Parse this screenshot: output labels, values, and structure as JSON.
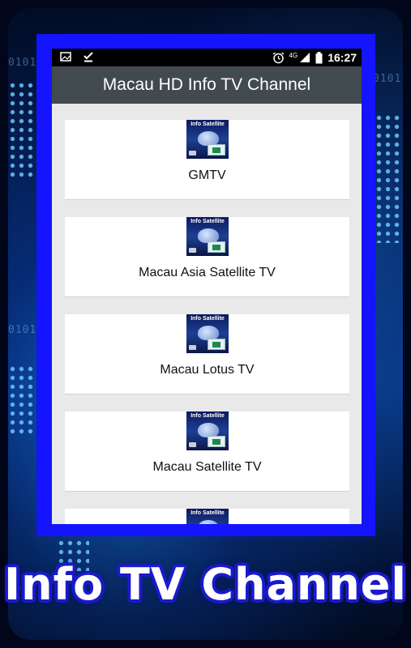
{
  "status_bar": {
    "time": "16:27",
    "network": "4G",
    "left_icons": [
      "image-icon",
      "download-done-icon"
    ],
    "right_icons": [
      "alarm-icon",
      "signal-icon",
      "battery-icon"
    ]
  },
  "app_bar": {
    "title": "Macau HD Info TV Channel"
  },
  "thumbnail": {
    "label": "Info Satellite"
  },
  "channels": [
    {
      "title": "GMTV"
    },
    {
      "title": "Macau Asia Satellite TV"
    },
    {
      "title": "Macau Lotus TV"
    },
    {
      "title": "Macau Satellite TV"
    },
    {
      "title": ""
    }
  ],
  "banner": {
    "text": "Info TV Channel"
  },
  "colors": {
    "frame_blue": "#1414ff",
    "app_bar": "#414a4f",
    "list_background": "#e9e9e9"
  }
}
